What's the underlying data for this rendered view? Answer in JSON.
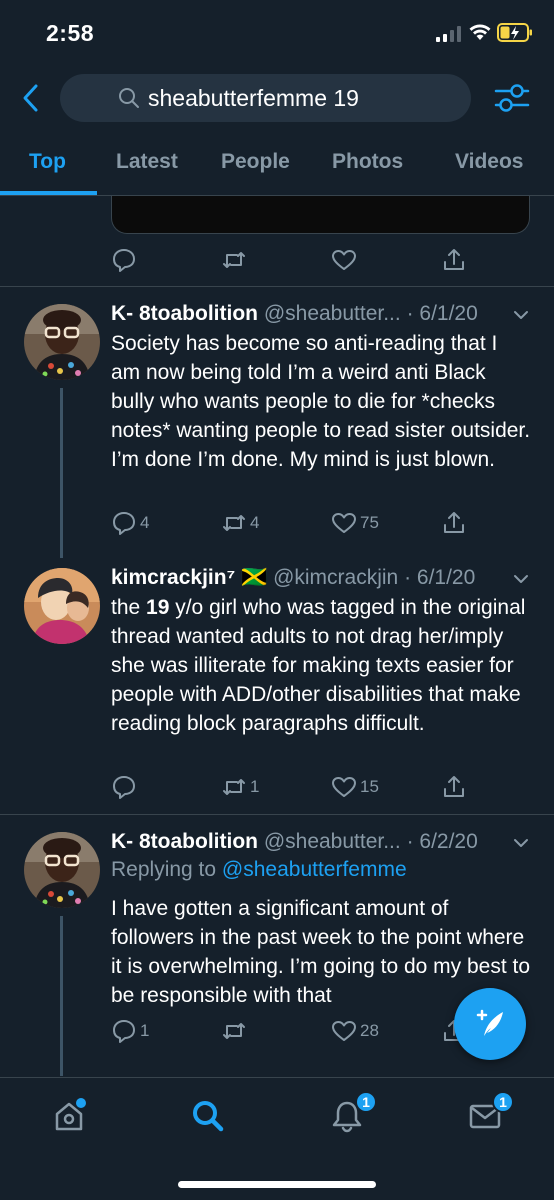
{
  "status_bar": {
    "time": "2:58"
  },
  "search": {
    "query": "sheabutterfemme 19"
  },
  "tabs": [
    {
      "label": "Top",
      "active": true
    },
    {
      "label": "Latest",
      "active": false
    },
    {
      "label": "People",
      "active": false
    },
    {
      "label": "Photos",
      "active": false
    },
    {
      "label": "Videos",
      "active": false
    }
  ],
  "tweets": [
    {
      "name": "K- 8toabolition",
      "handle": "@sheabutter...",
      "date": "· 6/1/20",
      "text": "Society has become so anti-reading that I am now being told I’m a weird anti Black bully who wants people to die for *checks notes* wanting people to read sister outsider. I’m done I’m done. My mind is just blown.",
      "replies": "4",
      "retweets": "4",
      "likes": "75"
    },
    {
      "name": "kimcrackjin⁷ 🇯🇲",
      "handle": "@kimcrackjin",
      "date": "· 6/1/20",
      "text_highlight": "19",
      "text_prefix": "the ",
      "text_suffix": " y/o girl who was tagged in the original thread wanted adults to not drag her/imply she was illiterate for making texts easier for people with ADD/other disabilities that make reading block paragraphs difficult.",
      "replies": "",
      "retweets": "1",
      "likes": "15"
    },
    {
      "name": "K- 8toabolition",
      "handle": "@sheabutter...",
      "date": "· 6/2/20",
      "replying_label": "Replying to",
      "replying_to": "@sheabutterfemme",
      "text": "I have gotten a significant amount of followers in the past week to the point where it is overwhelming. I’m going to do my best to be responsible with that",
      "replies": "1",
      "retweets": "",
      "likes": "28"
    }
  ],
  "tabbar": {
    "notifications_badge": "1",
    "messages_badge": "1"
  },
  "colors": {
    "background": "#15202b",
    "accent": "#1da1f2",
    "muted": "#8899a6",
    "divider": "#38444d"
  },
  "icons": [
    "back-chevron-icon",
    "search-icon",
    "filter-icon",
    "reply-icon",
    "retweet-icon",
    "like-icon",
    "share-icon",
    "compose-tweet-icon",
    "home-icon",
    "explore-icon",
    "notifications-icon",
    "messages-icon"
  ]
}
